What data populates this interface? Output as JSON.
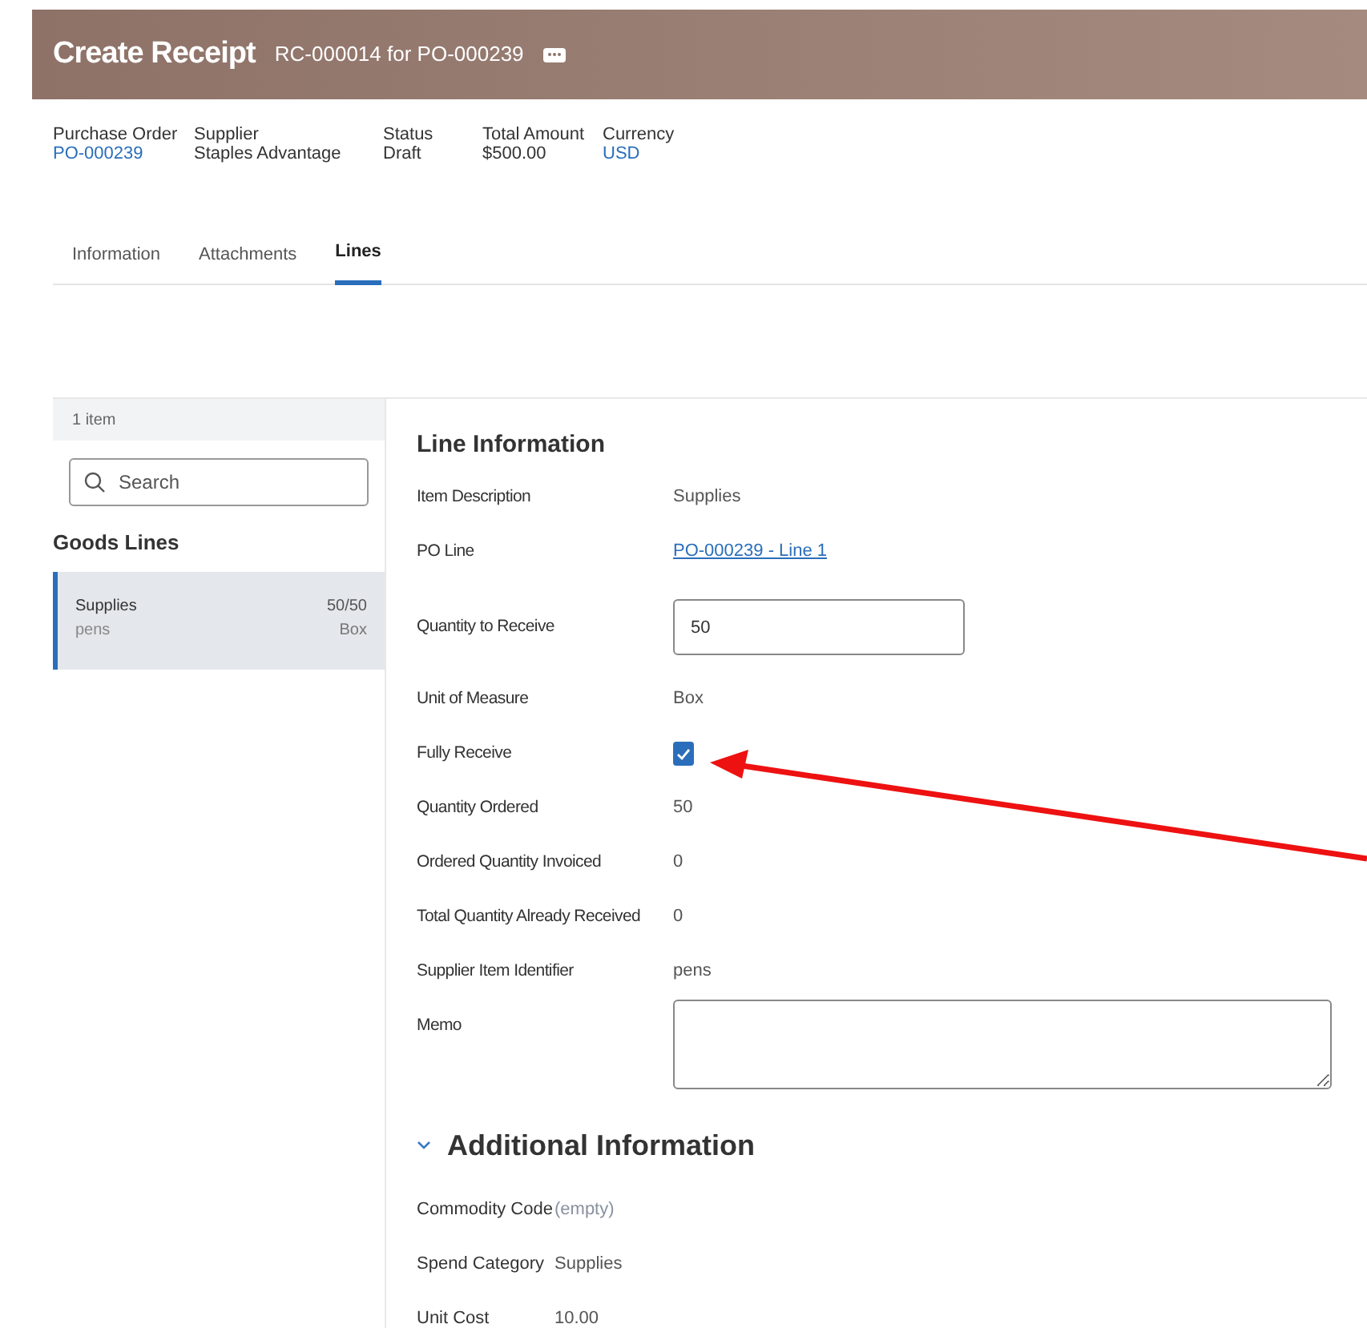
{
  "header": {
    "title": "Create Receipt",
    "subtitle": "RC-000014 for PO-000239"
  },
  "summary": [
    {
      "label": "Purchase Order",
      "value": "PO-000239",
      "link": true
    },
    {
      "label": "Supplier",
      "value": "Staples Advantage",
      "link": false
    },
    {
      "label": "Status",
      "value": "Draft",
      "link": false
    },
    {
      "label": "Total Amount",
      "value": "$500.00",
      "link": false
    },
    {
      "label": "Currency",
      "value": "USD",
      "link": true
    }
  ],
  "tabs": [
    {
      "label": "Information",
      "selected": false
    },
    {
      "label": "Attachments",
      "selected": false
    },
    {
      "label": "Lines",
      "selected": true
    }
  ],
  "sidebar": {
    "count": "1 item",
    "search": {
      "placeholder": "Search"
    },
    "heading": "Goods Lines",
    "items": [
      {
        "name": "Supplies",
        "detail": "pens",
        "quantity": "50/50",
        "unit": "Box",
        "selected": true
      }
    ]
  },
  "line_information": {
    "heading": "Line Information",
    "fields": [
      {
        "kind": "text",
        "label": "Item Description",
        "value": "Supplies"
      },
      {
        "kind": "link",
        "label": "PO Line",
        "value": "PO-000239 - Line 1"
      },
      {
        "kind": "input",
        "label": "Quantity to Receive",
        "value": "50"
      },
      {
        "kind": "text",
        "label": "Unit of Measure",
        "value": "Box"
      },
      {
        "kind": "checkbox",
        "label": "Fully Receive",
        "checked": true
      },
      {
        "kind": "text",
        "label": "Quantity Ordered",
        "value": "50"
      },
      {
        "kind": "text",
        "label": "Ordered Quantity Invoiced",
        "value": "0"
      },
      {
        "kind": "text",
        "label": "Total Quantity Already Received",
        "value": "0"
      },
      {
        "kind": "text",
        "label": "Supplier Item Identifier",
        "value": "pens"
      },
      {
        "kind": "textarea",
        "label": "Memo"
      }
    ]
  },
  "additional_information": {
    "heading": "Additional Information",
    "expanded": true,
    "fields": [
      {
        "label": "Commodity Code",
        "value": "(empty)",
        "empty": true
      },
      {
        "label": "Spend Category",
        "value": "Supplies",
        "empty": false
      },
      {
        "label": "Unit Cost",
        "value": "10.00",
        "empty": false
      }
    ]
  }
}
